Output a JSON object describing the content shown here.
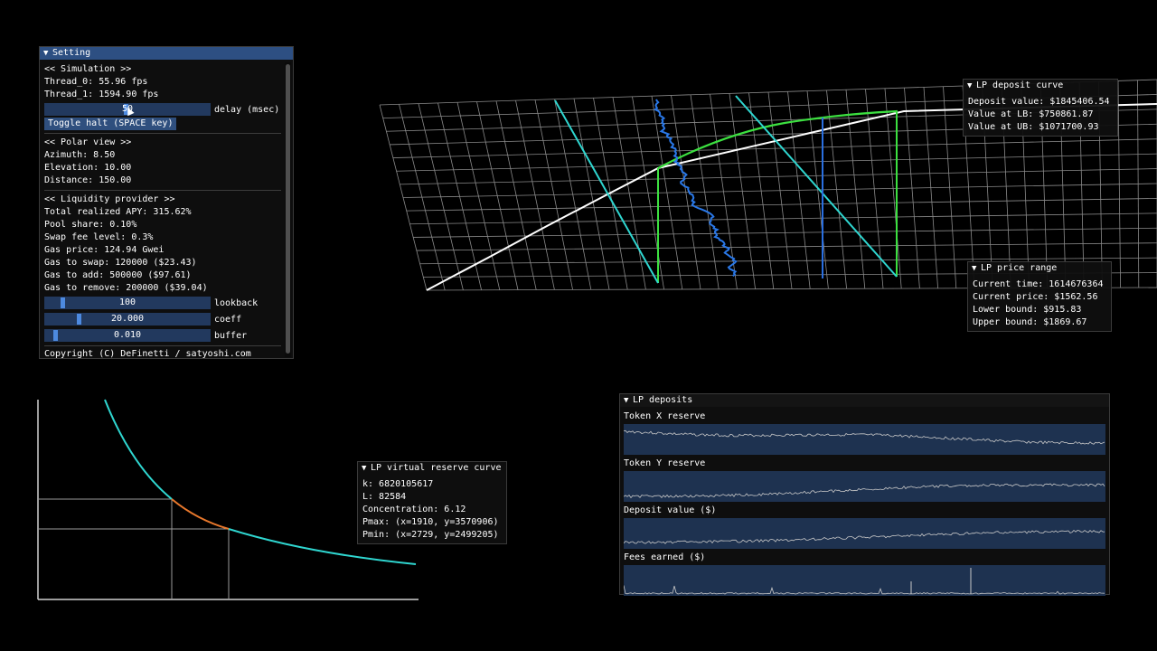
{
  "setting": {
    "title": "Setting",
    "simulation_header": "<< Simulation >>",
    "thread0": "Thread_0: 55.96 fps",
    "thread1": "Thread_1: 1594.90 fps",
    "delay_value": "50",
    "delay_label": "delay (msec)",
    "toggle_halt": "Toggle halt (SPACE key)",
    "polar_header": "<< Polar view >>",
    "azimuth": "Azimuth: 8.50",
    "elevation": "Elevation: 10.00",
    "distance": "Distance: 150.00",
    "lp_header": "<< Liquidity provider >>",
    "apy": "Total realized APY: 315.62%",
    "pool_share": "Pool share: 0.10%",
    "swap_fee": "Swap fee level: 0.3%",
    "gas_price": "Gas price: 124.94 Gwei",
    "gas_swap": "Gas to swap: 120000 ($23.43)",
    "gas_add": "Gas to add: 500000 ($97.61)",
    "gas_remove": "Gas to remove: 200000 ($39.04)",
    "lookback_value": "100",
    "lookback_label": "lookback",
    "coeff_value": "20.000",
    "coeff_label": "coeff",
    "buffer_value": "0.010",
    "buffer_label": "buffer",
    "copyright": "Copyright (C) DeFinetti / satyoshi.com"
  },
  "deposit_curve": {
    "title": "LP deposit curve",
    "deposit_value": "Deposit value: $1845406.54",
    "value_lb": "Value at LB: $750861.87",
    "value_ub": "Value at UB: $1071700.93"
  },
  "price_range": {
    "title": "LP price range",
    "current_time": "Current time: 1614676364",
    "current_price": "Current price: $1562.56",
    "lower_bound": "Lower bound: $915.83",
    "upper_bound": "Upper bound: $1869.67"
  },
  "virtual_reserve": {
    "title": "LP virtual reserve curve",
    "k": "k: 6820105617",
    "L": "L: 82584",
    "concentration": "Concentration: 6.12",
    "pmax": "Pmax: (x=1910, y=3570906)",
    "pmin": "Pmin: (x=2729, y=2499205)"
  },
  "deposits": {
    "title": "LP deposits",
    "plot_labels": [
      "Token X reserve",
      "Token Y reserve",
      "Deposit value ($)",
      "Fees earned ($)"
    ]
  },
  "colors": {
    "accent": "#2d4f82",
    "slider": "#22395e",
    "plot_bg": "#1e3250",
    "cyan": "#2fd6d0",
    "green": "#3ce040",
    "orange": "#e8782c",
    "blue": "#2a6fe0"
  }
}
